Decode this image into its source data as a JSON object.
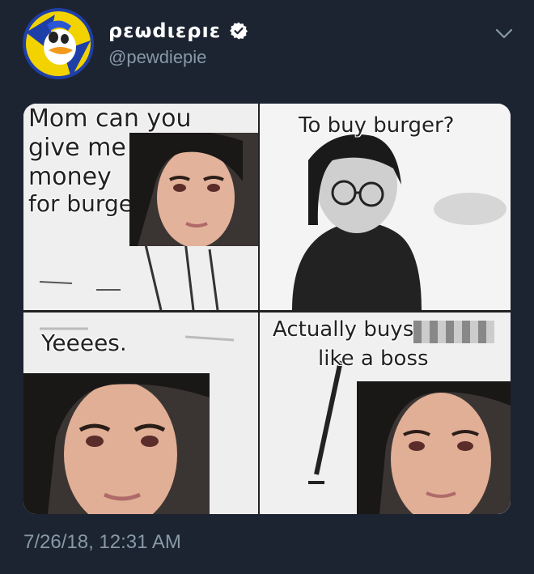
{
  "tweet": {
    "display_name": "ρεωdιερıε",
    "handle": "@pewdiepie",
    "timestamp": "7/26/18, 12:31 AM",
    "icons": {
      "avatar": "avatar-duck",
      "verified": "verified-badge-icon",
      "menu": "chevron-down-icon"
    }
  },
  "meme": {
    "panel1_lines": [
      "Mom can you",
      "give me",
      "money",
      "for burger"
    ],
    "panel2_text": "To buy burger?",
    "panel3_text": "Yeeees.",
    "panel4_line1": "Actually buys",
    "panel4_line2": "like a boss"
  },
  "colors": {
    "background": "#1c2431",
    "muted_text": "#8899a6",
    "accent": "#ffffff"
  }
}
